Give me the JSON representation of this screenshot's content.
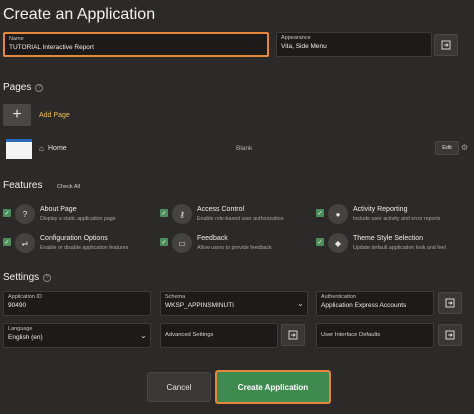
{
  "title": "Create an Application",
  "name_field": {
    "label": "Name",
    "value": "TUTORIAL Interactive Report"
  },
  "appearance_field": {
    "label": "Appearance",
    "value": "Vita, Side Menu"
  },
  "pages": {
    "heading": "Pages",
    "add_page_label": "Add Page",
    "items": [
      {
        "name": "Home",
        "type": "Blank",
        "edit_label": "Edit"
      }
    ]
  },
  "features": {
    "heading": "Features",
    "check_all_label": "Check All",
    "items": [
      {
        "title": "About Page",
        "desc": "Display a static application page",
        "icon": "question-icon"
      },
      {
        "title": "Access Control",
        "desc": "Enable role-based user authorization",
        "icon": "key-icon"
      },
      {
        "title": "Activity Reporting",
        "desc": "Include user activity and error reports",
        "icon": "user-icon"
      },
      {
        "title": "Configuration Options",
        "desc": "Enable or disable application features",
        "icon": "sliders-icon"
      },
      {
        "title": "Feedback",
        "desc": "Allow users to provide feedback",
        "icon": "comment-icon"
      },
      {
        "title": "Theme Style Selection",
        "desc": "Update default application look and feel",
        "icon": "palette-icon"
      }
    ]
  },
  "settings": {
    "heading": "Settings",
    "application_id": {
      "label": "Application ID",
      "value": "90490"
    },
    "schema": {
      "label": "Schema",
      "value": "WKSP_APPINSMINUTI"
    },
    "authentication": {
      "label": "Authentication",
      "value": "Application Express Accounts"
    },
    "language": {
      "label": "Language",
      "value": "English (en)"
    },
    "advanced_settings": {
      "label": "Advanced Settings"
    },
    "ui_defaults": {
      "label": "User Interface Defaults"
    }
  },
  "buttons": {
    "cancel": "Cancel",
    "create": "Create Application"
  },
  "colors": {
    "accent": "#e5873a",
    "primary": "#3f8a4e",
    "link": "#f3c15a",
    "background": "#2b2a28"
  }
}
